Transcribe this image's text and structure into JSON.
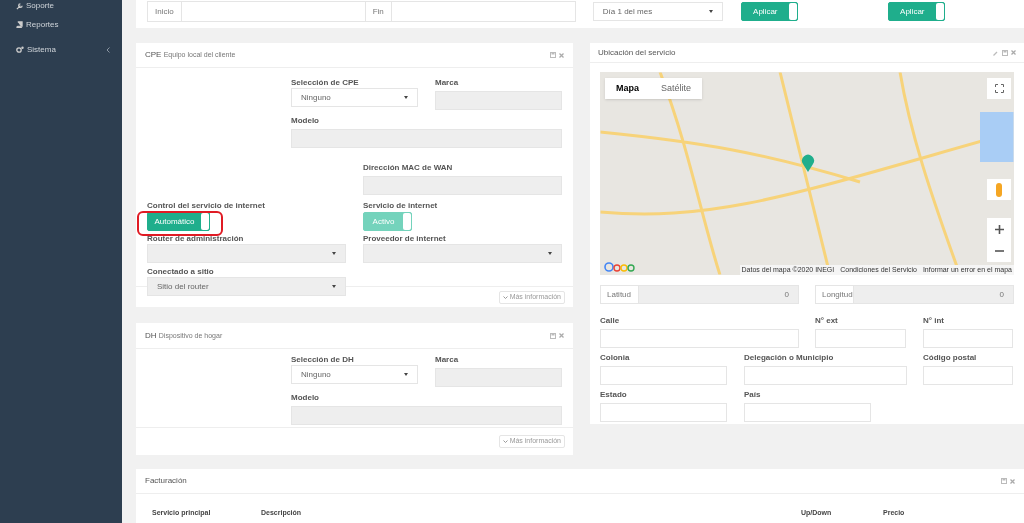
{
  "sidebar": {
    "items": [
      {
        "label": "Soporte"
      },
      {
        "label": "Reportes"
      },
      {
        "label": "Sistema",
        "has_submenu": true
      }
    ]
  },
  "filters": {
    "start": {
      "label": "Inicio"
    },
    "end": {
      "label": "Fin"
    },
    "day_select": {
      "value": "Día 1 del mes"
    },
    "apply_toggles": [
      {
        "label": "Aplicar",
        "on": true
      },
      {
        "label": "Aplicar",
        "on": true
      }
    ]
  },
  "cpe": {
    "title": "CPE",
    "subtitle": "Equipo local del cliente",
    "select": {
      "label": "Selección de CPE",
      "value": "Ninguno"
    },
    "brand": {
      "label": "Marca"
    },
    "model": {
      "label": "Modelo"
    },
    "mac": {
      "label": "Dirección MAC de WAN"
    },
    "control": {
      "label": "Control del servicio de internet",
      "toggle": {
        "label": "Automático",
        "on": true,
        "disabled": false
      },
      "highlighted": true
    },
    "service": {
      "label": "Servicio de internet",
      "toggle": {
        "label": "Activo",
        "on": true,
        "disabled": true
      }
    },
    "admin_router": {
      "label": "Router de administración"
    },
    "provider": {
      "label": "Proveedor de internet"
    },
    "site": {
      "label": "Conectado a sitio",
      "value": "Sitio del router"
    },
    "more": "Más información"
  },
  "dh": {
    "title": "DH",
    "subtitle": "Dispositivo de hogar",
    "select": {
      "label": "Selección de DH",
      "value": "Ninguno"
    },
    "brand": {
      "label": "Marca"
    },
    "model": {
      "label": "Modelo"
    },
    "more": "Más información"
  },
  "location": {
    "title": "Ubicación del servicio",
    "map": {
      "tabs": [
        {
          "label": "Mapa",
          "selected": true
        },
        {
          "label": "Satélite",
          "selected": false
        }
      ],
      "attribution": [
        "Datos del mapa ©2020 INEGI",
        "Condiciones del Servicio",
        "Informar un error en el mapa"
      ]
    },
    "latitude": {
      "label": "Latitud",
      "value": "0"
    },
    "longitude": {
      "label": "Longitud",
      "value": "0"
    },
    "fields": [
      "Calle",
      "N° ext",
      "N° int",
      "Colonia",
      "Delegación o Municipio",
      "Código postal",
      "Estado",
      "País"
    ]
  },
  "billing": {
    "title": "Facturación",
    "columns": [
      "Servicio principal",
      "Descripción",
      "Up/Down",
      "Precio"
    ]
  }
}
